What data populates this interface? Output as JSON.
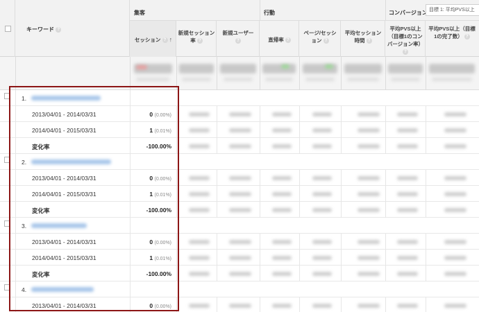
{
  "header": {
    "keyword_label": "キーワード",
    "acquisition_label": "集客",
    "behavior_label": "行動",
    "conversion_label": "コンバージョン",
    "goal_select_value": "目標 1: 平均PVS以上",
    "columns": [
      "セッション",
      "新規セッション率",
      "新規ユーザー",
      "直帰率",
      "ページ/セッション",
      "平均セッション時間",
      "平均PVS以上（目標1のコンバージョン率）",
      "平均PVS以上（目標1の完了数）"
    ],
    "help_glyph": "?",
    "sort_glyph": "↑"
  },
  "rows": [
    {
      "number": "1.",
      "period1": "2013/04/01 - 2014/03/31",
      "period1_sessions": "0",
      "period1_pct": "(0.00%)",
      "period2": "2014/04/01 - 2015/03/31",
      "period2_sessions": "1",
      "period2_pct": "(0.01%)",
      "change_label": "変化率",
      "change_value": "-100.00%"
    },
    {
      "number": "2.",
      "period1": "2013/04/01 - 2014/03/31",
      "period1_sessions": "0",
      "period1_pct": "(0.00%)",
      "period2": "2014/04/01 - 2015/03/31",
      "period2_sessions": "1",
      "period2_pct": "(0.01%)",
      "change_label": "変化率",
      "change_value": "-100.00%"
    },
    {
      "number": "3.",
      "period1": "2013/04/01 - 2014/03/31",
      "period1_sessions": "0",
      "period1_pct": "(0.00%)",
      "period2": "2014/04/01 - 2015/03/31",
      "period2_sessions": "1",
      "period2_pct": "(0.01%)",
      "change_label": "変化率",
      "change_value": "-100.00%"
    },
    {
      "number": "4.",
      "period1": "2013/04/01 - 2014/03/31",
      "period1_sessions": "0",
      "period1_pct": "(0.00%)"
    }
  ],
  "colors": {
    "highlight_frame": "#8c1515",
    "blurred_keyword": "#a9c7ea",
    "header_bg": "#f2f2f2"
  }
}
